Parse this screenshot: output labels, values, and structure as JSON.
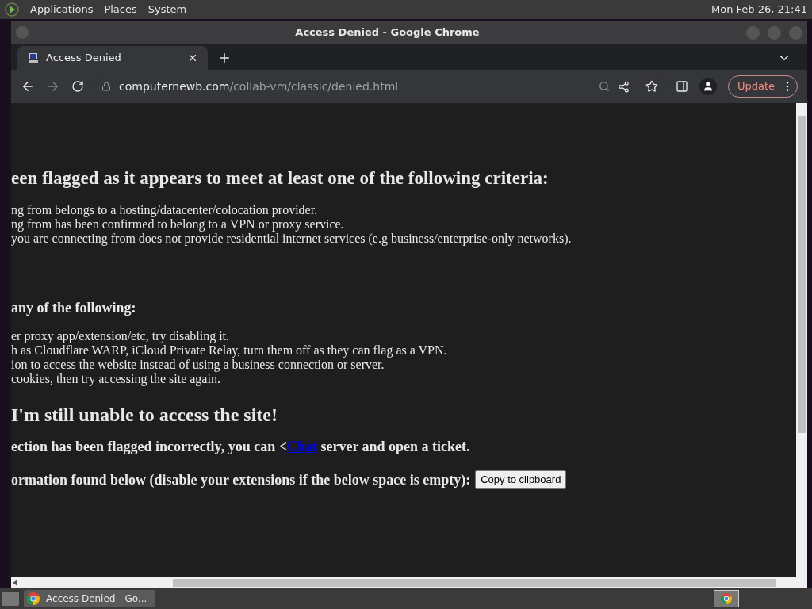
{
  "top_panel": {
    "menus": [
      "Applications",
      "Places",
      "System"
    ],
    "clock": "Mon Feb 26, 21:41"
  },
  "window": {
    "title": "Access Denied - Google Chrome"
  },
  "tabs": [
    {
      "label": "Access Denied",
      "selected": true
    }
  ],
  "toolbar": {
    "url_host": "computernewb.com",
    "url_path": "/collab-vm/classic/denied.html",
    "update_label": "Update"
  },
  "page": {
    "heading_criteria": "een flagged as it appears to meet at least one of the following criteria:",
    "criteria": [
      "ng from belongs to a hosting/datacenter/colocation provider.",
      "ng from has been confirmed to belong to a VPN or proxy service.",
      "you are connecting from does not provide residential internet services (e.g business/enterprise-only networks)."
    ],
    "heading_fixes": "any of the following:",
    "fixes": [
      "er proxy app/extension/etc, try disabling it.",
      "h as Cloudflare WARP, iCloud Private Relay, turn them off as they can flag as a VPN.",
      "ion to access the website instead of using a business connection or server.",
      "cookies, then try accessing the site again."
    ],
    "heading_still": "I'm still unable to access the site!",
    "ticket_before": "ection has been flagged incorrectly, you can <",
    "ticket_link": "Chat",
    "ticket_after": " server and open a ticket.",
    "info_text": "ormation found below (disable your extensions if the below space is empty):",
    "copy_button": "Copy to clipboard"
  },
  "taskbar": {
    "items": [
      {
        "label": "Access Denied - Go...",
        "selected": true
      }
    ]
  }
}
